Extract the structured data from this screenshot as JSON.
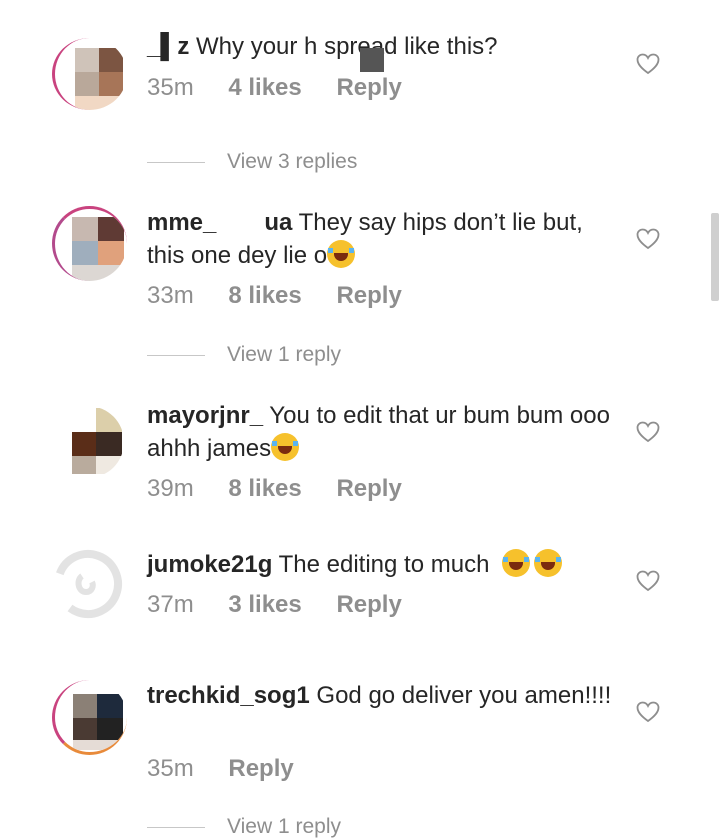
{
  "comments": [
    {
      "username": "_▌z",
      "text": "Why your h spread like this?",
      "time": "35m",
      "likes": "4 likes",
      "reply": "Reply",
      "view_replies": "View 3 replies",
      "avatar_colors": [
        "#cfc3b9",
        "#7c5542",
        "#b9a89a",
        "#a77558",
        "#f1d8c4"
      ]
    },
    {
      "username": "mme_  ua",
      "text": "They say hips don’t lie but, this one dey lie o",
      "time": "33m",
      "likes": "8 likes",
      "reply": "Reply",
      "view_replies": "View 1 reply",
      "avatar_colors": [
        "#c7b8b0",
        "#5f3a34",
        "#9faebd",
        "#e0a17c",
        "#dcd7d3"
      ]
    },
    {
      "username": "mayorjnr_",
      "text": "You to edit that ur bum bum ooo ahhh james",
      "time": "39m",
      "likes": "8 likes",
      "reply": "Reply",
      "avatar_colors": [
        "#dccfaa",
        "#5a2d18",
        "#3a2a23",
        "#b9ab9d",
        "#efe9e1"
      ]
    },
    {
      "username": "jumoke21g",
      "text": "The editing to much",
      "time": "37m",
      "likes": "3 likes",
      "reply": "Reply"
    },
    {
      "username": "trechkid_sog1",
      "text": "God go deliver you amen!!!!",
      "time": "35m",
      "reply": "Reply",
      "view_replies": "View 1 reply",
      "avatar_colors": [
        "#8b8076",
        "#1e2a3c",
        "#4a3a33",
        "#222222",
        "#e5dcd6"
      ]
    }
  ],
  "colors": {
    "text": "#262626",
    "meta": "#8e8e8e",
    "story_ring": "#d3337f"
  }
}
